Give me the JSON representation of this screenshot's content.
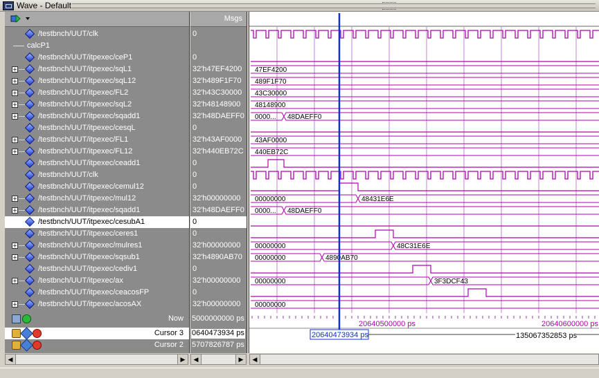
{
  "window": {
    "title": "Wave - Default"
  },
  "header": {
    "msgs_label": "Msgs"
  },
  "rows": [
    {
      "name": "/testbnch/UUT/clk",
      "value": "0",
      "expand": false,
      "kind": "signal"
    },
    {
      "name": "calcP1",
      "value": "",
      "expand": false,
      "kind": "group"
    },
    {
      "name": "/testbnch/UUT/itpexec/ceP1",
      "value": "0",
      "expand": false,
      "kind": "signal"
    },
    {
      "name": "/testbnch/UUT/itpexec/sqL1",
      "value": "32'h47EF4200",
      "expand": true,
      "kind": "signal"
    },
    {
      "name": "/testbnch/UUT/itpexec/sqL12",
      "value": "32'h489F1F70",
      "expand": true,
      "kind": "signal"
    },
    {
      "name": "/testbnch/UUT/itpexec/FL2",
      "value": "32'h43C30000",
      "expand": true,
      "kind": "signal"
    },
    {
      "name": "/testbnch/UUT/itpexec/sqL2",
      "value": "32'h48148900",
      "expand": true,
      "kind": "signal"
    },
    {
      "name": "/testbnch/UUT/itpexec/sqadd1",
      "value": "32'h48DAEFF0",
      "expand": true,
      "kind": "signal"
    },
    {
      "name": "/testbnch/UUT/itpexec/cesqL",
      "value": "0",
      "expand": false,
      "kind": "signal"
    },
    {
      "name": "/testbnch/UUT/itpexec/FL1",
      "value": "32'h43AF0000",
      "expand": true,
      "kind": "signal"
    },
    {
      "name": "/testbnch/UUT/itpexec/FL12",
      "value": "32'h440EB72C",
      "expand": true,
      "kind": "signal"
    },
    {
      "name": "/testbnch/UUT/itpexec/ceadd1",
      "value": "0",
      "expand": false,
      "kind": "signal"
    },
    {
      "name": "/testbnch/UUT/clk",
      "value": "0",
      "expand": false,
      "kind": "signal"
    },
    {
      "name": "/testbnch/UUT/itpexec/cemul12",
      "value": "0",
      "expand": false,
      "kind": "signal"
    },
    {
      "name": "/testbnch/UUT/itpexec/mul12",
      "value": "32'h00000000",
      "expand": true,
      "kind": "signal"
    },
    {
      "name": "/testbnch/UUT/itpexec/sqadd1",
      "value": "32'h48DAEFF0",
      "expand": true,
      "kind": "signal"
    },
    {
      "name": "/testbnch/UUT/itpexec/cesubA1",
      "value": "0",
      "expand": false,
      "kind": "signal",
      "selected": true
    },
    {
      "name": "/testbnch/UUT/itpexec/ceres1",
      "value": "0",
      "expand": false,
      "kind": "signal"
    },
    {
      "name": "/testbnch/UUT/itpexec/mulres1",
      "value": "32'h00000000",
      "expand": true,
      "kind": "signal"
    },
    {
      "name": "/testbnch/UUT/itpexec/sqsub1",
      "value": "32'h4890AB70",
      "expand": true,
      "kind": "signal"
    },
    {
      "name": "/testbnch/UUT/itpexec/cediv1",
      "value": "0",
      "expand": false,
      "kind": "signal"
    },
    {
      "name": "/testbnch/UUT/itpexec/ax",
      "value": "32'h00000000",
      "expand": true,
      "kind": "signal"
    },
    {
      "name": "/testbnch/UUT/itpexec/ceacosFP",
      "value": "0",
      "expand": false,
      "kind": "signal"
    },
    {
      "name": "/testbnch/UUT/itpexec/acosAX",
      "value": "32'h00000000",
      "expand": true,
      "kind": "signal"
    }
  ],
  "waves": {
    "bus_labels": {
      "sqL1": "47EF4200",
      "sqL12": "489F1F70",
      "FL2": "43C30000",
      "sqL2": "48148900",
      "sqadd1_before": "0000...",
      "sqadd1_after": "48DAEFF0",
      "FL1": "43AF0000",
      "FL12": "440EB72C",
      "mul12_before": "00000000",
      "mul12_after": "48431E6E",
      "sqadd1b_before": "0000...",
      "sqadd1b_after": "48DAEFF0",
      "mulres1_before": "00000000",
      "mulres1_after": "48C31E6E",
      "sqsub1_before": "00000000",
      "sqsub1_after": "4890AB70",
      "ax_before": "00000000",
      "ax_after": "3F3DCF43",
      "acosAX": "00000000"
    },
    "timeline": {
      "left_label": "20640500000 ps",
      "right_label": "20640600000 ps"
    },
    "cursor_labels": {
      "cursor3": "20640473934 ps",
      "delta": "135067352853 ps"
    },
    "colors": {
      "signal": "#b000b0",
      "cursor": "#1030d0",
      "grid": "#9a30b0"
    }
  },
  "bottom": {
    "now_label": "Now",
    "now_value": "5000000000 ps",
    "cursor3_label": "Cursor 3",
    "cursor3_value": "0640473934 ps",
    "cursor2_label": "Cursor 2",
    "cursor2_value": "5707826787 ps"
  }
}
